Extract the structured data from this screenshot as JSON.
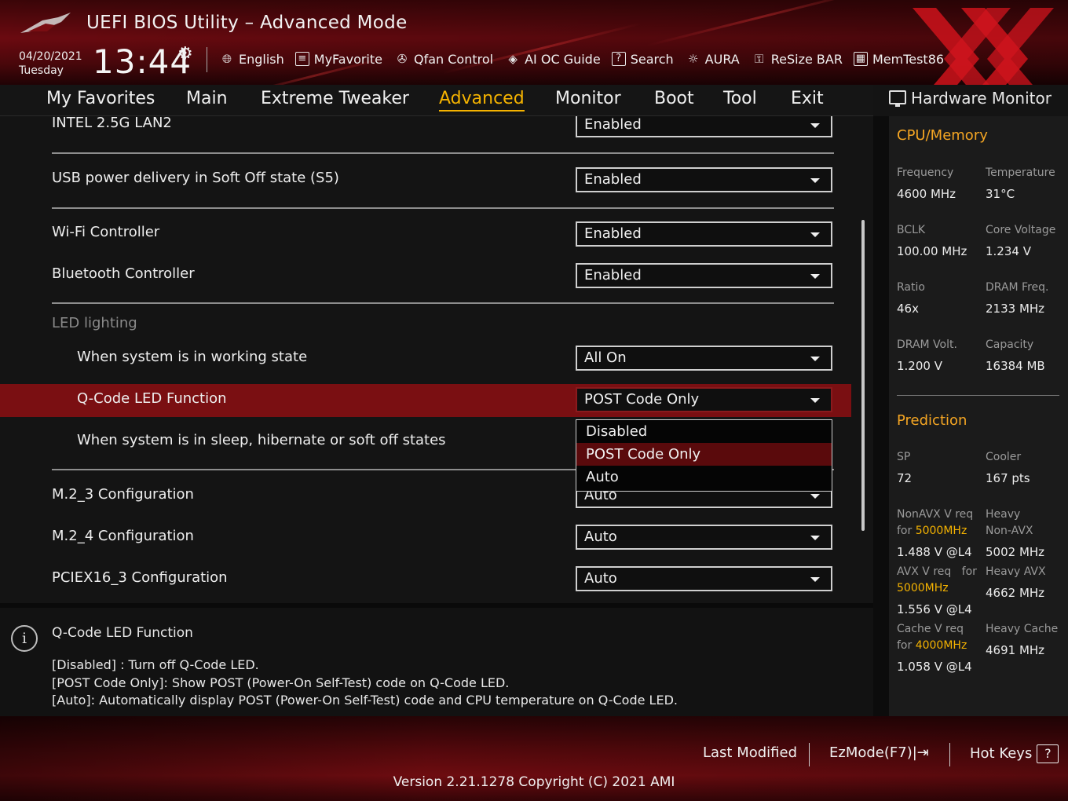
{
  "header": {
    "title": "UEFI BIOS Utility – Advanced Mode",
    "date": "04/20/2021",
    "day": "Tuesday",
    "time": "13:44",
    "toolbar": [
      {
        "label": "English",
        "icon": "globe-icon"
      },
      {
        "label": "MyFavorite",
        "icon": "favorite-icon"
      },
      {
        "label": "Qfan Control",
        "icon": "fan-icon"
      },
      {
        "label": "AI OC Guide",
        "icon": "ai-oc-icon"
      },
      {
        "label": "Search",
        "icon": "search-icon"
      },
      {
        "label": "AURA",
        "icon": "aura-icon"
      },
      {
        "label": "ReSize BAR",
        "icon": "resize-bar-icon"
      },
      {
        "label": "MemTest86",
        "icon": "memtest-icon"
      }
    ]
  },
  "nav": {
    "tabs": [
      "My Favorites",
      "Main",
      "Extreme Tweaker",
      "Advanced",
      "Monitor",
      "Boot",
      "Tool",
      "Exit"
    ],
    "active": "Advanced"
  },
  "settings": {
    "intel_lan": {
      "label": "INTEL 2.5G LAN2",
      "value": "Enabled"
    },
    "usb_power": {
      "label": "USB power delivery in Soft Off state (S5)",
      "value": "Enabled"
    },
    "wifi": {
      "label": "Wi-Fi Controller",
      "value": "Enabled"
    },
    "bluetooth": {
      "label": "Bluetooth Controller",
      "value": "Enabled"
    },
    "led_header": "LED lighting",
    "led_working": {
      "label": "When system is in working state",
      "value": "All On"
    },
    "qcode": {
      "label": "Q-Code LED Function",
      "value": "POST Code Only"
    },
    "led_sleep": {
      "label": "When system is in sleep, hibernate or soft off states"
    },
    "m2_3": {
      "label": "M.2_3 Configuration",
      "value": "Auto"
    },
    "m2_4": {
      "label": "M.2_4 Configuration",
      "value": "Auto"
    },
    "pciex16_3": {
      "label": "PCIEX16_3 Configuration",
      "value": "Auto"
    }
  },
  "dropdown": {
    "options": [
      "Disabled",
      "POST Code Only",
      "Auto"
    ],
    "selected": "POST Code Only"
  },
  "help": {
    "title": "Q-Code LED Function",
    "lines": [
      "[Disabled] : Turn off Q-Code LED.",
      "[POST Code Only]: Show POST (Power-On Self-Test) code on Q-Code LED.",
      "[Auto]: Automatically display POST (Power-On Self-Test) code and CPU temperature on Q-Code LED."
    ]
  },
  "hwmon": {
    "title": "Hardware Monitor",
    "cpu_section": "CPU/Memory",
    "cpu": [
      {
        "label": "Frequency",
        "value": "4600 MHz"
      },
      {
        "label": "Temperature",
        "value": "31°C"
      },
      {
        "label": "BCLK",
        "value": "100.00 MHz"
      },
      {
        "label": "Core Voltage",
        "value": "1.234 V"
      },
      {
        "label": "Ratio",
        "value": "46x"
      },
      {
        "label": "DRAM Freq.",
        "value": "2133 MHz"
      },
      {
        "label": "DRAM Volt.",
        "value": "1.200 V"
      },
      {
        "label": "Capacity",
        "value": "16384 MB"
      }
    ],
    "prediction_section": "Prediction",
    "sp": {
      "label": "SP",
      "value": "72"
    },
    "cooler": {
      "label": "Cooler",
      "value": "167 pts"
    },
    "nonavx": {
      "label1": "NonAVX V req",
      "label2": "for",
      "freq": "5000MHz",
      "value": "1.488 V @L4"
    },
    "heavy_nonavx": {
      "label1": "Heavy",
      "label2": "Non-AVX",
      "value": "5002 MHz"
    },
    "avx": {
      "label1": "AVX V req",
      "label2": "for",
      "freq": "5000MHz",
      "value": "1.556 V @L4"
    },
    "heavy_avx": {
      "label": "Heavy AVX",
      "value": "4662 MHz"
    },
    "cache": {
      "label1": "Cache V req",
      "label2": "for",
      "freq": "4000MHz",
      "value": "1.058 V @L4"
    },
    "heavy_cache": {
      "label": "Heavy Cache",
      "value": "4691 MHz"
    }
  },
  "footer": {
    "last_modified": "Last Modified",
    "ezmode": "EzMode(F7)|",
    "hotkeys": "Hot Keys",
    "hotkeys_key": "?",
    "version": "Version 2.21.1278 Copyright (C) 2021 AMI"
  }
}
